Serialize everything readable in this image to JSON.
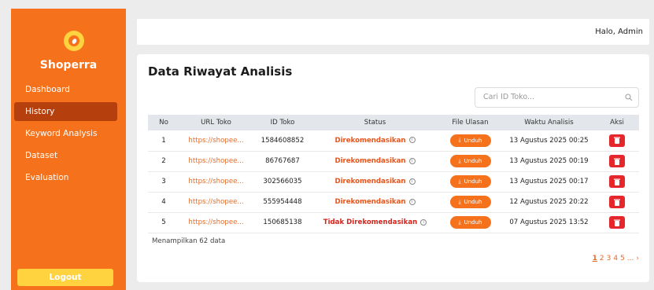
{
  "sidebar": {
    "brand": "Shoperra",
    "items": [
      {
        "label": "Dashboard"
      },
      {
        "label": "History"
      },
      {
        "label": "Keyword Analysis"
      },
      {
        "label": "Dataset"
      },
      {
        "label": "Evaluation"
      }
    ],
    "logout": "Logout"
  },
  "topbar": {
    "greeting": "Halo, Admin"
  },
  "main": {
    "title": "Data Riwayat Analisis",
    "search_placeholder": "Cari ID Toko...",
    "columns": [
      "No",
      "URL Toko",
      "ID Toko",
      "Status",
      "File Ulasan",
      "Waktu Analisis",
      "Aksi"
    ],
    "rows": [
      {
        "no": "1",
        "url": "https://shopee...",
        "id": "1584608852",
        "status": "Direkomendasikan",
        "file": "Unduh",
        "time": "13 Agustus 2025 00:25"
      },
      {
        "no": "2",
        "url": "https://shopee...",
        "id": "86767687",
        "status": "Direkomendasikan",
        "file": "Unduh",
        "time": "13 Agustus 2025 00:19"
      },
      {
        "no": "3",
        "url": "https://shopee...",
        "id": "302566035",
        "status": "Direkomendasikan",
        "file": "Unduh",
        "time": "13 Agustus 2025 00:17"
      },
      {
        "no": "4",
        "url": "https://shopee...",
        "id": "555954448",
        "status": "Direkomendasikan",
        "file": "Unduh",
        "time": "12 Agustus 2025 20:22"
      },
      {
        "no": "5",
        "url": "https://shopee...",
        "id": "150685138",
        "status": "Tidak Direkomendasikan",
        "file": "Unduh",
        "time": "07 Agustus 2025 13:52"
      }
    ],
    "footer": "Menampilkan 62 data",
    "pages": [
      "1",
      "2",
      "3",
      "4",
      "5",
      "...",
      "›"
    ]
  },
  "colors": {
    "primary": "#f6711b",
    "active": "#b5400d",
    "accent": "#ffd23f",
    "danger": "#e5262b"
  }
}
